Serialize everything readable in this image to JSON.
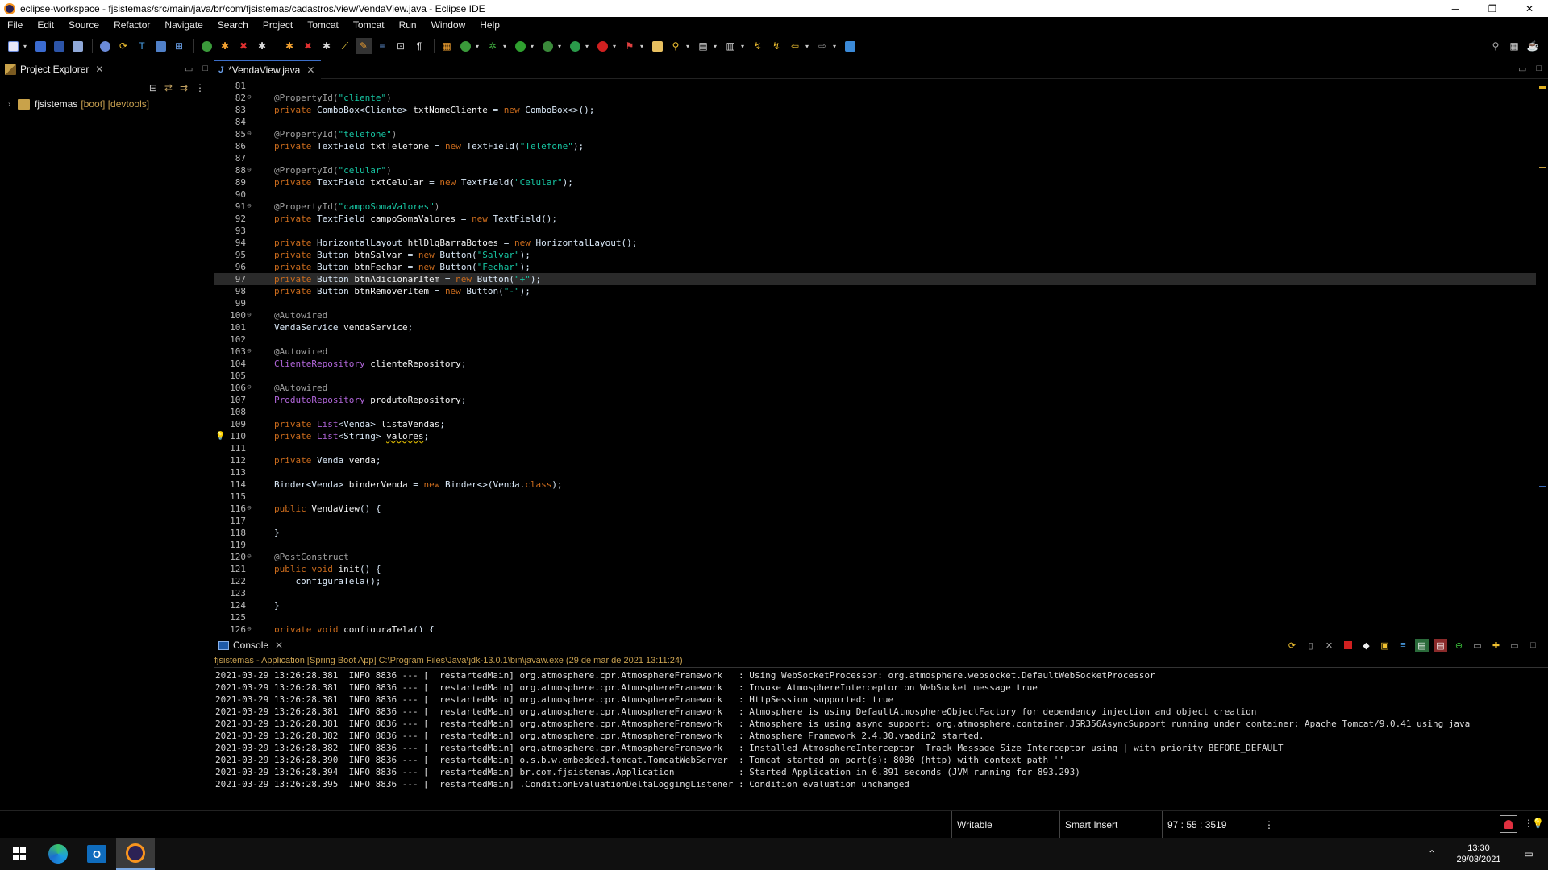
{
  "window": {
    "title": "eclipse-workspace - fjsistemas/src/main/java/br/com/fjsistemas/cadastros/view/VendaView.java - Eclipse IDE",
    "minimize": "─",
    "restore": "❐",
    "close": "✕"
  },
  "menu": [
    "File",
    "Edit",
    "Source",
    "Refactor",
    "Navigate",
    "Search",
    "Project",
    "Tomcat",
    "Tomcat",
    "Run",
    "Window",
    "Help"
  ],
  "project_explorer": {
    "tab_label": "Project Explorer",
    "close": "✕",
    "project_name": "fjsistemas",
    "project_decoration": "[boot] [devtools]"
  },
  "editor": {
    "tab_label": "*VendaView.java",
    "close": "✕",
    "lines": [
      {
        "n": "81",
        "fold": "",
        "html": ""
      },
      {
        "n": "82",
        "fold": "⊖",
        "html": "<span class=\"annot\">@PropertyId(</span><span class=\"s\">\"cliente\"</span><span class=\"annot\">)</span>"
      },
      {
        "n": "83",
        "fold": "",
        "html": "<span class=\"k\">private</span> ComboBox&lt;Cliente&gt; <span class=\"bold\">txtNomeCliente</span> = <span class=\"k\">new</span> ComboBox&lt;&gt;();"
      },
      {
        "n": "84",
        "fold": "",
        "html": ""
      },
      {
        "n": "85",
        "fold": "⊖",
        "html": "<span class=\"annot\">@PropertyId(</span><span class=\"s\">\"telefone\"</span><span class=\"annot\">)</span>"
      },
      {
        "n": "86",
        "fold": "",
        "html": "<span class=\"k\">private</span> TextField <span class=\"bold\">txtTelefone</span> = <span class=\"k\">new</span> TextField(<span class=\"s\">\"Telefone\"</span>);"
      },
      {
        "n": "87",
        "fold": "",
        "html": ""
      },
      {
        "n": "88",
        "fold": "⊖",
        "html": "<span class=\"annot\">@PropertyId(</span><span class=\"s\">\"celular\"</span><span class=\"annot\">)</span>"
      },
      {
        "n": "89",
        "fold": "",
        "html": "<span class=\"k\">private</span> TextField <span class=\"bold\">txtCelular</span> = <span class=\"k\">new</span> TextField(<span class=\"s\">\"Celular\"</span>);"
      },
      {
        "n": "90",
        "fold": "",
        "html": ""
      },
      {
        "n": "91",
        "fold": "⊖",
        "html": "<span class=\"annot\">@PropertyId(</span><span class=\"s\">\"campoSomaValores\"</span><span class=\"annot\">)</span>"
      },
      {
        "n": "92",
        "fold": "",
        "html": "<span class=\"k\">private</span> TextField <span class=\"bold\">campoSomaValores</span> = <span class=\"k\">new</span> TextField();"
      },
      {
        "n": "93",
        "fold": "",
        "html": ""
      },
      {
        "n": "94",
        "fold": "",
        "html": "<span class=\"k\">private</span> HorizontalLayout <span class=\"bold\">htlDlgBarraBotoes</span> = <span class=\"k\">new</span> HorizontalLayout();"
      },
      {
        "n": "95",
        "fold": "",
        "html": "<span class=\"k\">private</span> Button <span class=\"bold\">btnSalvar</span> = <span class=\"k\">new</span> Button(<span class=\"s\">\"Salvar\"</span>);"
      },
      {
        "n": "96",
        "fold": "",
        "html": "<span class=\"k\">private</span> Button <span class=\"bold\">btnFechar</span> = <span class=\"k\">new</span> Button(<span class=\"s\">\"Fechar\"</span>);"
      },
      {
        "n": "97",
        "fold": "",
        "current": true,
        "html": "<span class=\"k\">private</span> Button <span class=\"bold\">btnAdicionarItem</span> = <span class=\"k\">new</span> Button(<span class=\"s\">\"+\"</span>);"
      },
      {
        "n": "98",
        "fold": "",
        "html": "<span class=\"k\">private</span> Button <span class=\"bold\">btnRemoverItem</span> = <span class=\"k\">new</span> Button(<span class=\"s\">\"-\"</span>);"
      },
      {
        "n": "99",
        "fold": "",
        "html": ""
      },
      {
        "n": "100",
        "fold": "⊖",
        "html": "<span class=\"annot\">@Autowired</span>"
      },
      {
        "n": "101",
        "fold": "",
        "html": "VendaService <span class=\"bold\">vendaService</span>;"
      },
      {
        "n": "102",
        "fold": "",
        "html": ""
      },
      {
        "n": "103",
        "fold": "⊖",
        "html": "<span class=\"annot\">@Autowired</span>"
      },
      {
        "n": "104",
        "fold": "",
        "html": "<span class=\"ifc\">ClienteRepository</span> <span class=\"bold\">clienteRepository</span>;"
      },
      {
        "n": "105",
        "fold": "",
        "html": ""
      },
      {
        "n": "106",
        "fold": "⊖",
        "html": "<span class=\"annot\">@Autowired</span>"
      },
      {
        "n": "107",
        "fold": "",
        "html": "<span class=\"ifc\">ProdutoRepository</span> <span class=\"bold\">produtoRepository</span>;"
      },
      {
        "n": "108",
        "fold": "",
        "html": ""
      },
      {
        "n": "109",
        "fold": "",
        "html": "<span class=\"k\">private</span> <span class=\"ifc\">List</span>&lt;Venda&gt; <span class=\"bold\">listaVendas</span>;"
      },
      {
        "n": "110",
        "fold": "",
        "bulb": true,
        "html": "<span class=\"k\">private</span> <span class=\"ifc\">List</span>&lt;String&gt; <span class=\"bold warn\">valores</span>;"
      },
      {
        "n": "111",
        "fold": "",
        "html": ""
      },
      {
        "n": "112",
        "fold": "",
        "html": "<span class=\"k\">private</span> Venda <span class=\"bold\">venda</span>;"
      },
      {
        "n": "113",
        "fold": "",
        "html": ""
      },
      {
        "n": "114",
        "fold": "",
        "html": "Binder&lt;Venda&gt; <span class=\"bold\">binderVenda</span> = <span class=\"k\">new</span> Binder&lt;&gt;(Venda.<span class=\"k\">class</span>);"
      },
      {
        "n": "115",
        "fold": "",
        "html": ""
      },
      {
        "n": "116",
        "fold": "⊖",
        "html": "<span class=\"k\">public</span> <span class=\"bold\">VendaView</span>() {"
      },
      {
        "n": "117",
        "fold": "",
        "html": ""
      },
      {
        "n": "118",
        "fold": "",
        "html": "}"
      },
      {
        "n": "119",
        "fold": "",
        "html": ""
      },
      {
        "n": "120",
        "fold": "⊖",
        "html": "<span class=\"annot\">@PostConstruct</span>"
      },
      {
        "n": "121",
        "fold": "",
        "html": "<span class=\"k\">public</span> <span class=\"k\">void</span> <span class=\"bold\">init</span>() {"
      },
      {
        "n": "122",
        "fold": "",
        "html": "    configuraTela();"
      },
      {
        "n": "123",
        "fold": "",
        "html": ""
      },
      {
        "n": "124",
        "fold": "",
        "html": "}"
      },
      {
        "n": "125",
        "fold": "",
        "html": ""
      },
      {
        "n": "126",
        "fold": "⊖",
        "html": "<span class=\"k\">private</span> <span class=\"k\">void</span> <span class=\"bold\">configuraTela</span>() {"
      }
    ]
  },
  "console": {
    "tab_label": "Console",
    "close": "✕",
    "header": "fjsistemas - Application [Spring Boot App] C:\\Program Files\\Java\\jdk-13.0.1\\bin\\javaw.exe  (29 de mar de 2021 13:11:24)",
    "lines": [
      "2021-03-29 13:26:28.381  INFO 8836 --- [  restartedMain] org.atmosphere.cpr.AtmosphereFramework   : Using WebSocketProcessor: org.atmosphere.websocket.DefaultWebSocketProcessor",
      "2021-03-29 13:26:28.381  INFO 8836 --- [  restartedMain] org.atmosphere.cpr.AtmosphereFramework   : Invoke AtmosphereInterceptor on WebSocket message true",
      "2021-03-29 13:26:28.381  INFO 8836 --- [  restartedMain] org.atmosphere.cpr.AtmosphereFramework   : HttpSession supported: true",
      "2021-03-29 13:26:28.381  INFO 8836 --- [  restartedMain] org.atmosphere.cpr.AtmosphereFramework   : Atmosphere is using DefaultAtmosphereObjectFactory for dependency injection and object creation",
      "2021-03-29 13:26:28.381  INFO 8836 --- [  restartedMain] org.atmosphere.cpr.AtmosphereFramework   : Atmosphere is using async support: org.atmosphere.container.JSR356AsyncSupport running under container: Apache Tomcat/9.0.41 using java",
      "2021-03-29 13:26:28.382  INFO 8836 --- [  restartedMain] org.atmosphere.cpr.AtmosphereFramework   : Atmosphere Framework 2.4.30.vaadin2 started.",
      "2021-03-29 13:26:28.382  INFO 8836 --- [  restartedMain] org.atmosphere.cpr.AtmosphereFramework   : Installed AtmosphereInterceptor  Track Message Size Interceptor using | with priority BEFORE_DEFAULT",
      "2021-03-29 13:26:28.390  INFO 8836 --- [  restartedMain] o.s.b.w.embedded.tomcat.TomcatWebServer  : Tomcat started on port(s): 8080 (http) with context path ''",
      "2021-03-29 13:26:28.394  INFO 8836 --- [  restartedMain] br.com.fjsistemas.Application            : Started Application in 6.891 seconds (JVM running for 893.293)",
      "2021-03-29 13:26:28.395  INFO 8836 --- [  restartedMain] .ConditionEvaluationDeltaLoggingListener : Condition evaluation unchanged"
    ]
  },
  "status": {
    "writable": "Writable",
    "insert_mode": "Smart Insert",
    "position": "97 : 55 : 3519",
    "more": "⋮"
  },
  "taskbar": {
    "time": "13:30",
    "date": "29/03/2021"
  },
  "colors": {
    "accent": "#3c6ec8",
    "keyword": "#cc6c1d",
    "string": "#17c6a3"
  }
}
